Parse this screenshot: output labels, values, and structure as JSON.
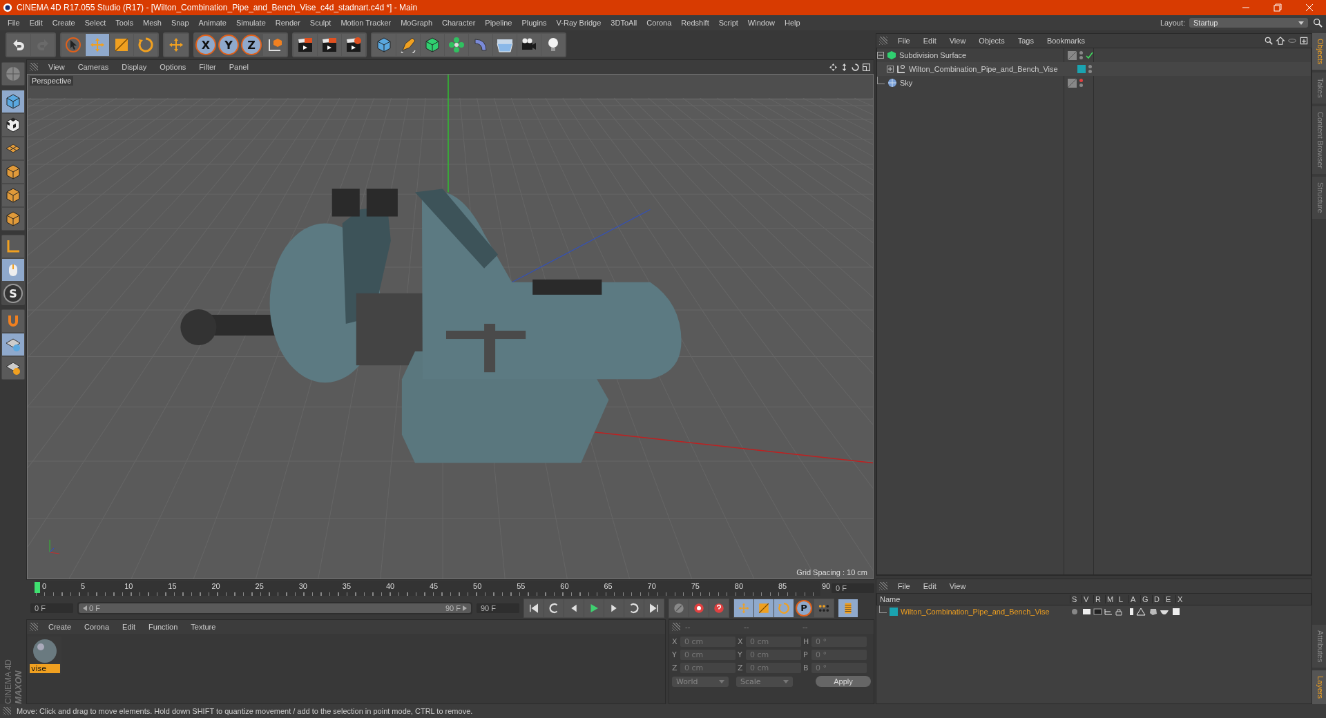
{
  "title_bar": {
    "title": "CINEMA 4D R17.055 Studio (R17) - [Wilton_Combination_Pipe_and_Bench_Vise_c4d_stadnart.c4d *] - Main"
  },
  "menu_bar": [
    "File",
    "Edit",
    "Create",
    "Select",
    "Tools",
    "Mesh",
    "Snap",
    "Animate",
    "Simulate",
    "Render",
    "Sculpt",
    "Motion Tracker",
    "MoGraph",
    "Character",
    "Pipeline",
    "Plugins",
    "V-Ray Bridge",
    "3DToAll",
    "Corona",
    "Redshift",
    "Script",
    "Window",
    "Help"
  ],
  "layout": {
    "label": "Layout:",
    "value": "Startup"
  },
  "toolbar": {
    "axis_buttons": [
      "X",
      "Y",
      "Z"
    ]
  },
  "left_tools": {
    "snap_letter": "S"
  },
  "viewport": {
    "menu": [
      "View",
      "Cameras",
      "Display",
      "Options",
      "Filter",
      "Panel"
    ],
    "camera": "Perspective",
    "grid_spacing": "Grid Spacing : 10 cm"
  },
  "timeline": {
    "ticks": [
      "0",
      "5",
      "10",
      "15",
      "20",
      "25",
      "30",
      "35",
      "40",
      "45",
      "50",
      "55",
      "60",
      "65",
      "70",
      "75",
      "80",
      "85",
      "90"
    ],
    "level": 0,
    "current_frame": "0 F",
    "start_frame": "0 F",
    "range": {
      "start": "0 F",
      "end": "90 F",
      "level": 1
    },
    "end_frame": "90 F",
    "keyframe_letter": "P"
  },
  "material_manager": {
    "menu": [
      "Create",
      "Corona",
      "Edit",
      "Function",
      "Texture"
    ],
    "materials": [
      {
        "name": "vise",
        "selected": true
      }
    ]
  },
  "coordinates": {
    "headers": [
      "--",
      "--",
      "--"
    ],
    "rows": [
      {
        "pos_axis": "X",
        "pos": "0 cm",
        "size_axis": "X",
        "size": "0 cm",
        "rot_axis": "H",
        "rot": "0 °"
      },
      {
        "pos_axis": "Y",
        "pos": "0 cm",
        "size_axis": "Y",
        "size": "0 cm",
        "rot_axis": "P",
        "rot": "0 °"
      },
      {
        "pos_axis": "Z",
        "pos": "0 cm",
        "size_axis": "Z",
        "size": "0 cm",
        "rot_axis": "B",
        "rot": "0 °"
      }
    ],
    "dropdowns": [
      "World",
      "Scale"
    ],
    "apply": "Apply"
  },
  "logo": {
    "brand": "MAXON",
    "product": "CINEMA 4D"
  },
  "status_bar": "Move: Click and drag to move elements. Hold down SHIFT to quantize movement / add to the selection in point mode, CTRL to remove.",
  "object_manager": {
    "menu": [
      "File",
      "Edit",
      "View",
      "Objects",
      "Tags",
      "Bookmarks"
    ],
    "objects": [
      {
        "name": "Subdivision Surface",
        "kind": "subdivision",
        "expanded": true,
        "enabled": true,
        "editor_hidden": false,
        "children": [
          {
            "name": "Wilton_Combination_Pipe_and_Bench_Vise",
            "kind": "null",
            "expanded": false,
            "enabled": false,
            "editor_hidden": false,
            "color": "#1aa3b0"
          }
        ]
      },
      {
        "name": "Sky",
        "kind": "sky",
        "enabled": false,
        "editor_hidden": true
      }
    ]
  },
  "layer_manager": {
    "menu": [
      "File",
      "Edit",
      "View"
    ],
    "columns": [
      "Name",
      "S",
      "V",
      "R",
      "M",
      "L",
      "A",
      "G",
      "D",
      "E",
      "X"
    ],
    "layers": [
      {
        "name": "Wilton_Combination_Pipe_and_Bench_Vise",
        "color": "#1aa3b0"
      }
    ]
  },
  "side_tabs_top": [
    {
      "label": "Objects",
      "selected": true
    },
    {
      "label": "Takes",
      "selected": false
    },
    {
      "label": "Content Browser",
      "selected": false
    },
    {
      "label": "Structure",
      "selected": false
    }
  ],
  "side_tabs_bottom": [
    {
      "label": "Attributes",
      "selected": false
    },
    {
      "label": "Layers",
      "selected": true
    }
  ]
}
